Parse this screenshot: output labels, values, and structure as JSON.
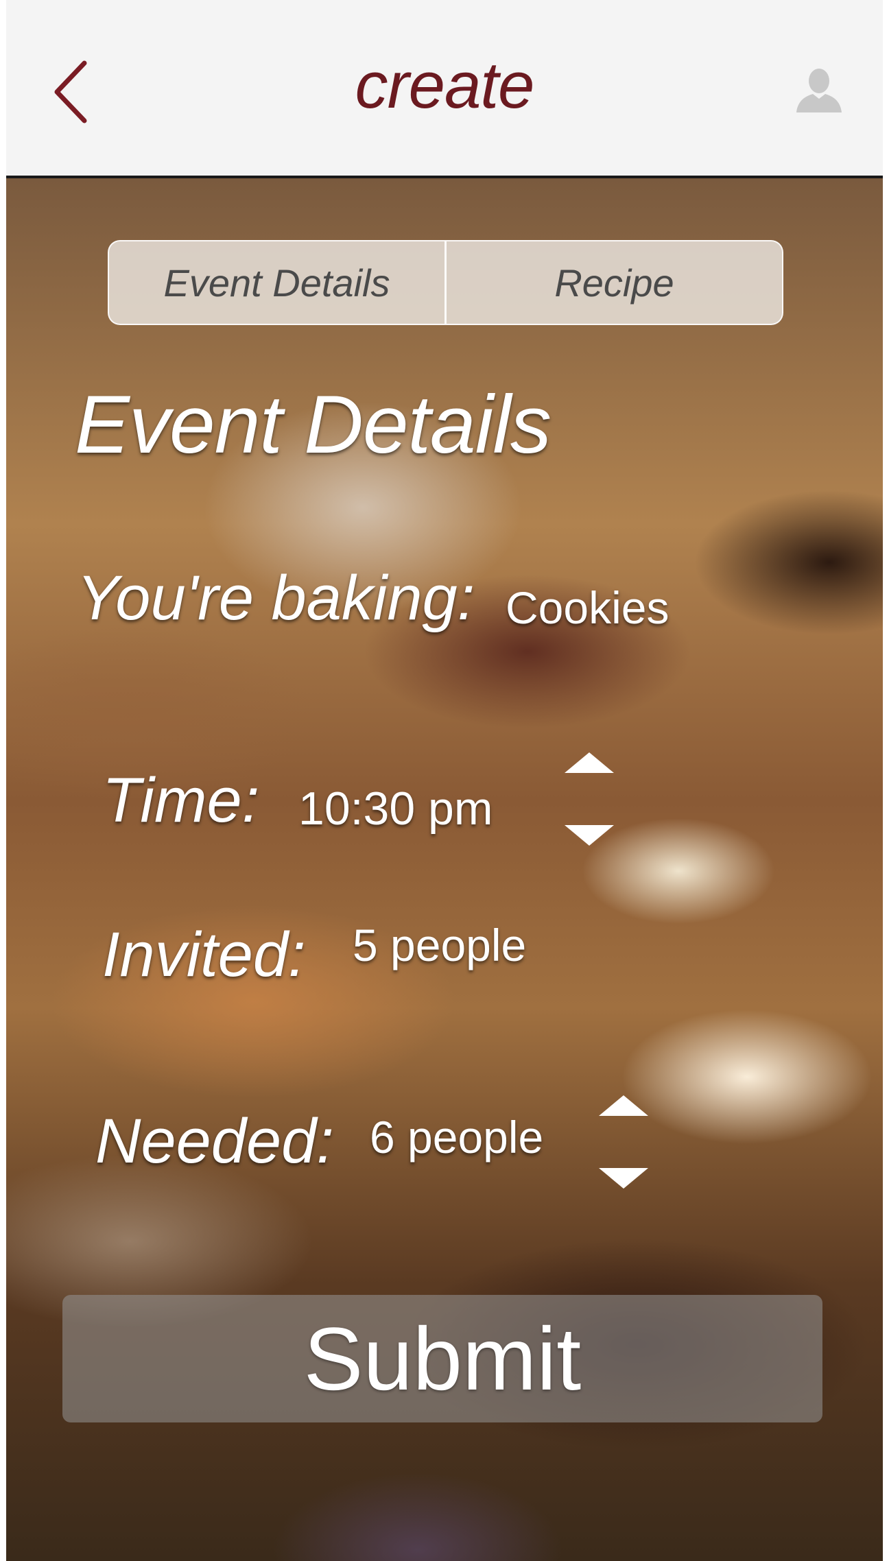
{
  "header": {
    "title": "create",
    "back_icon": "chevron-left-icon",
    "profile_icon": "user-silhouette-icon",
    "accent_color": "#6b1a20"
  },
  "tabs": [
    {
      "label": "Event Details",
      "selected": true
    },
    {
      "label": "Recipe",
      "selected": false
    }
  ],
  "section_title": "Event Details",
  "fields": {
    "baking": {
      "label": "You're baking:",
      "value": "Cookies"
    },
    "time": {
      "label": "Time:",
      "value": "10:30 pm",
      "stepper_icons": [
        "triangle-up-icon",
        "triangle-down-icon"
      ]
    },
    "invited": {
      "label": "Invited:",
      "value": "5 people"
    },
    "needed": {
      "label": "Needed:",
      "value": "6 people",
      "stepper_icons": [
        "triangle-up-icon",
        "triangle-down-icon"
      ]
    }
  },
  "submit_label": "Submit"
}
